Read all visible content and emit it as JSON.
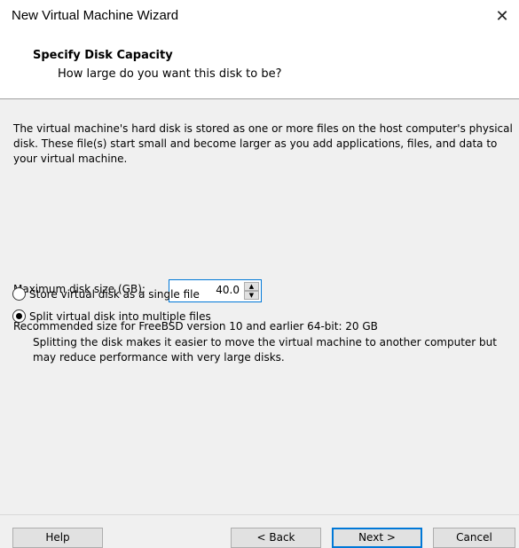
{
  "window": {
    "title": "New Virtual Machine Wizard",
    "close_glyph": "✕"
  },
  "header": {
    "title": "Specify Disk Capacity",
    "subtitle": "How large do you want this disk to be?"
  },
  "body": {
    "description": "The virtual machine's hard disk is stored as one or more files on the host computer's physical disk. These file(s) start small and become larger as you add applications, files, and data to your virtual machine.",
    "max_size_label": "Maximum disk size (GB):",
    "max_size_value": "40.0",
    "recommended": "Recommended size for FreeBSD version 10 and earlier 64-bit: 20 GB",
    "options": [
      {
        "label": "Store virtual disk as a single file",
        "selected": false
      },
      {
        "label": "Split virtual disk into multiple files",
        "selected": true
      }
    ],
    "split_help": "Splitting the disk makes it easier to move the virtual machine to another computer but may reduce performance with very large disks."
  },
  "footer": {
    "help": "Help",
    "back": "< Back",
    "next": "Next >",
    "cancel": "Cancel"
  }
}
